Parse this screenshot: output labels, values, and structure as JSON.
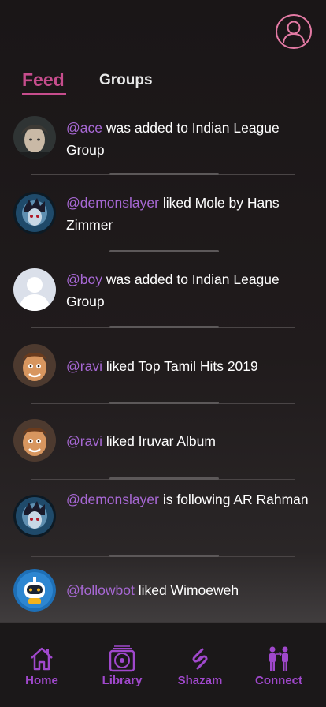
{
  "header": {
    "profile_icon": "user-circle-icon",
    "tabs": [
      {
        "label": "Feed",
        "active": true
      },
      {
        "label": "Groups",
        "active": false
      }
    ]
  },
  "colors": {
    "accent": "#c74d8d",
    "handle": "#a768d4",
    "nav": "#a048cc"
  },
  "feed": [
    {
      "handle": "@ace",
      "text": " was added to Indian League Group",
      "avatar": "avatar-ace"
    },
    {
      "handle": "@demonslayer",
      "text": " liked Mole by Hans Zimmer",
      "avatar": "avatar-demonslayer"
    },
    {
      "handle": "@boy",
      "text": " was added to Indian League Group",
      "avatar": "avatar-default-person"
    },
    {
      "handle": "@ravi",
      "text": " liked Top Tamil Hits 2019",
      "avatar": "avatar-ravi"
    },
    {
      "handle": "@ravi",
      "text": " liked Iruvar Album",
      "avatar": "avatar-ravi"
    },
    {
      "handle": "@demonslayer",
      "text": " is following AR Rahman",
      "avatar": "avatar-demonslayer"
    },
    {
      "handle": "@followbot",
      "text": " liked Wimoeweh",
      "avatar": "avatar-robot"
    }
  ],
  "nav": [
    {
      "label": "Home",
      "icon": "home-icon"
    },
    {
      "label": "Library",
      "icon": "library-icon"
    },
    {
      "label": "Shazam",
      "icon": "shazam-icon"
    },
    {
      "label": "Connect",
      "icon": "connect-icon"
    }
  ]
}
